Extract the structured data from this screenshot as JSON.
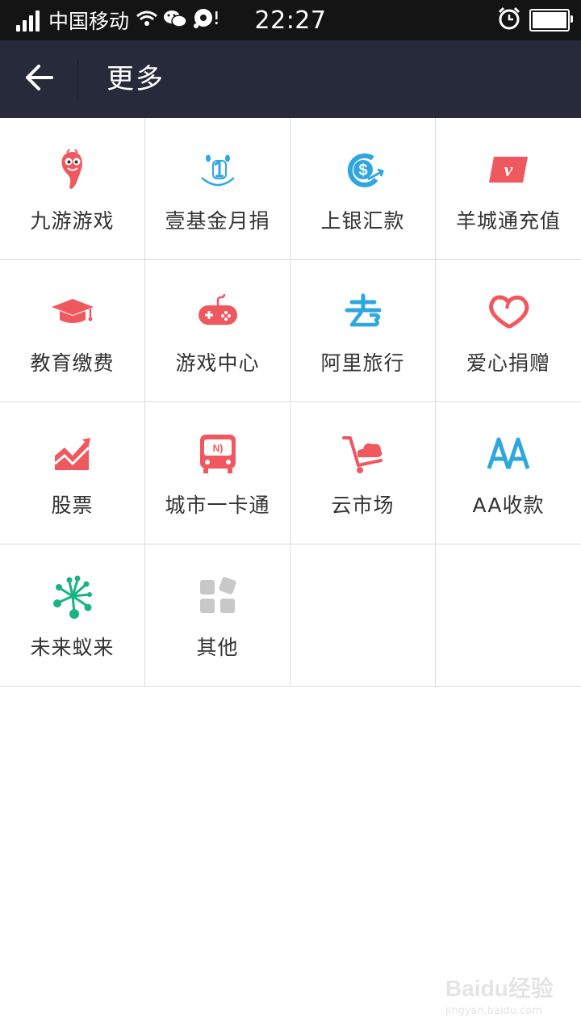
{
  "status_bar": {
    "carrier": "中国移动",
    "time": "22:27",
    "signal_level": 4,
    "battery_level": 1.0
  },
  "nav": {
    "title": "更多",
    "back_icon": "arrow-left-icon"
  },
  "colors": {
    "status_bar_bg": "#141414",
    "nav_bg": "#272a3a",
    "grid_border": "#dcdcdc",
    "red": "#f0585f",
    "blue": "#2ea7e0",
    "green": "#18b383",
    "gray": "#c8c8c8"
  },
  "grid": [
    {
      "label": "九游游戏",
      "icon": "jiuyou-icon"
    },
    {
      "label": "壹基金月捐",
      "icon": "onefoundation-icon"
    },
    {
      "label": "上银汇款",
      "icon": "remittance-icon"
    },
    {
      "label": "羊城通充值",
      "icon": "yangchengtong-icon"
    },
    {
      "label": "教育缴费",
      "icon": "graduation-cap-icon"
    },
    {
      "label": "游戏中心",
      "icon": "gamepad-icon"
    },
    {
      "label": "阿里旅行",
      "icon": "alitrip-icon"
    },
    {
      "label": "爱心捐赠",
      "icon": "heart-icon"
    },
    {
      "label": "股票",
      "icon": "stock-chart-icon"
    },
    {
      "label": "城市一卡通",
      "icon": "city-card-icon"
    },
    {
      "label": "云市场",
      "icon": "cloud-cart-icon"
    },
    {
      "label": "AA收款",
      "icon": "aa-icon"
    },
    {
      "label": "未来蚁来",
      "icon": "ant-future-icon"
    },
    {
      "label": "其他",
      "icon": "more-apps-icon"
    },
    {
      "label": "",
      "icon": ""
    },
    {
      "label": "",
      "icon": ""
    }
  ],
  "watermark": {
    "main": "Baidu经验",
    "sub": "jingyan.baidu.com"
  }
}
